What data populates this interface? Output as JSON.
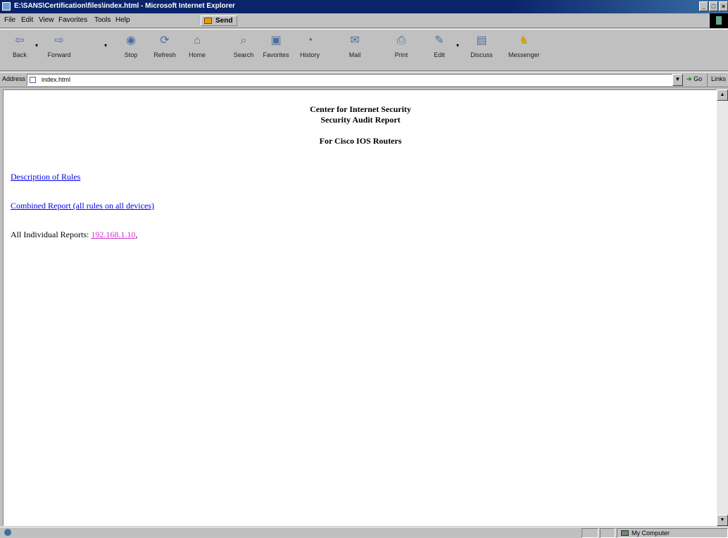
{
  "window": {
    "title": "E:\\SANS\\Certification\\files\\index.html - Microsoft Internet Explorer",
    "buttons": [
      "_",
      "□",
      "×"
    ]
  },
  "menu": {
    "items": [
      "File",
      "Edit",
      "View",
      "Favorites",
      "Tools",
      "Help"
    ],
    "send_label": "Send"
  },
  "toolbar": {
    "buttons": [
      {
        "label": "Back",
        "icon": "back-arrow-icon"
      },
      {
        "label": "Forward",
        "icon": "forward-arrow-icon"
      },
      {
        "label": "Stop",
        "icon": "stop-icon"
      },
      {
        "label": "Refresh",
        "icon": "refresh-icon"
      },
      {
        "label": "Home",
        "icon": "home-icon"
      },
      {
        "label": "Search",
        "icon": "search-icon"
      },
      {
        "label": "Favorites",
        "icon": "favorites-icon"
      },
      {
        "label": "History",
        "icon": "history-icon"
      },
      {
        "label": "Mail",
        "icon": "mail-icon"
      },
      {
        "label": "Print",
        "icon": "print-icon"
      },
      {
        "label": "Edit",
        "icon": "edit-icon"
      },
      {
        "label": "Discuss",
        "icon": "discuss-icon"
      },
      {
        "label": "Messenger",
        "icon": "messenger-icon"
      }
    ]
  },
  "address": {
    "label": "Address",
    "value": "index.html",
    "go_label": "Go",
    "links_label": "Links"
  },
  "page": {
    "heading_line1": "Center for Internet Security",
    "heading_line2": "Security Audit Report",
    "heading_line3": "For Cisco IOS Routers",
    "link_rules": "Description of Rules",
    "link_combined": "Combined Report (all rules on all devices)",
    "individual_label": "All Individual Reports:",
    "individual_link": "192.168.1.10",
    "individual_suffix": ","
  },
  "status": {
    "zone": "My Computer"
  },
  "colors": {
    "link": "#0000ee",
    "visited": "#cc33cc",
    "titlebar": "#0a246a"
  }
}
